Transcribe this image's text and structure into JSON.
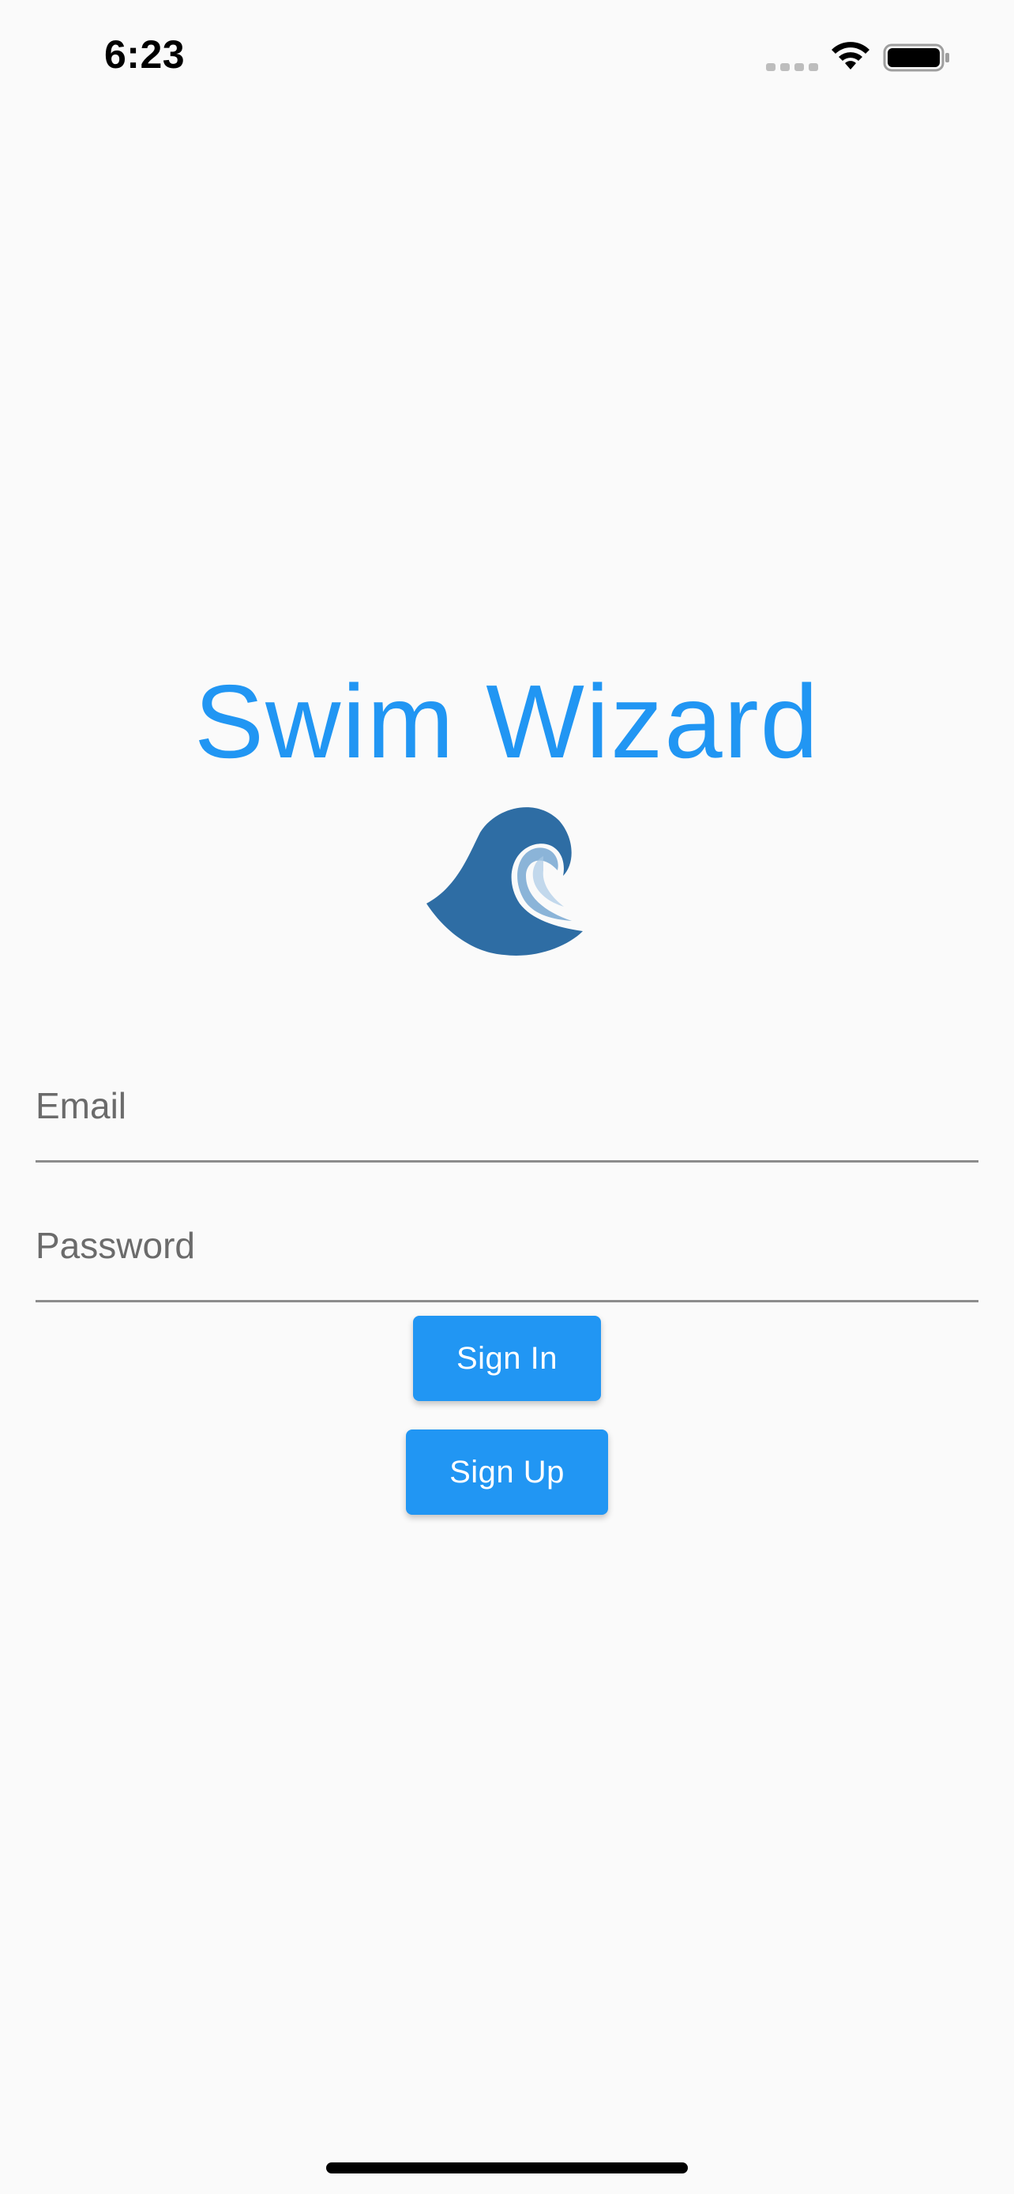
{
  "status_bar": {
    "time": "6:23",
    "icons": [
      "signal-dots-icon",
      "wifi-icon",
      "battery-icon"
    ]
  },
  "app": {
    "title": "Swim Wizard",
    "logo": "wave-logo",
    "accent_color": "#2196f3"
  },
  "form": {
    "email": {
      "placeholder": "Email",
      "value": ""
    },
    "password": {
      "placeholder": "Password",
      "value": ""
    },
    "sign_in_label": "Sign In",
    "sign_up_label": "Sign Up"
  }
}
